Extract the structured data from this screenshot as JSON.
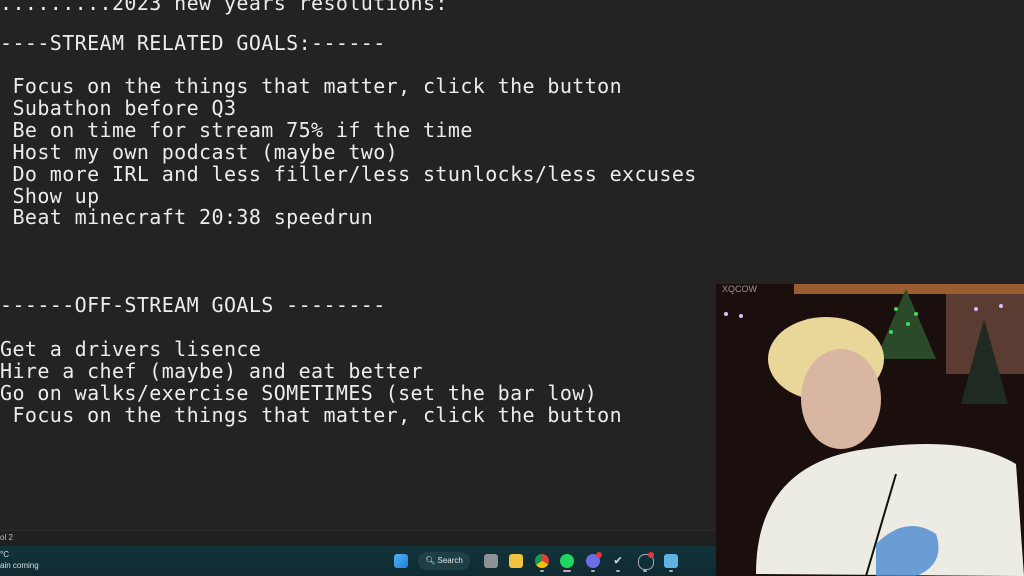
{
  "editor": {
    "title_line": ".........2023 new years resolutions:",
    "stream_header": "----STREAM RELATED GOALS:------",
    "stream_goals": [
      " Focus on the things that matter, click the button",
      " Subathon before Q3",
      " Be on time for stream 75% if the time",
      " Host my own podcast (maybe two)",
      " Do more IRL and less filler/less stunlocks/less excuses",
      " Show up",
      " Beat minecraft 20:38 speedrun"
    ],
    "offstream_header": "------OFF-STREAM GOALS --------",
    "offstream_goals": [
      "Get a drivers lisence",
      "Hire a chef (maybe) and eat better",
      "Go on walks/exercise SOMETIMES (set the bar low)",
      " Focus on the things that matter, click the button"
    ]
  },
  "statusbar": {
    "position": "ol 2"
  },
  "taskbar": {
    "weather_temp": "°C",
    "weather_desc": "ain coming",
    "search_label": "Search",
    "icons": [
      "windows-start-icon",
      "task-view-icon",
      "file-explorer-icon",
      "chrome-icon",
      "spotify-icon",
      "discord-icon",
      "steam-icon",
      "app-icon",
      "notepad-icon"
    ]
  },
  "webcam": {
    "overlay_label": "XQCOW"
  },
  "colors": {
    "background": "#232323",
    "text": "#ececec",
    "taskbar": "#12333a"
  }
}
